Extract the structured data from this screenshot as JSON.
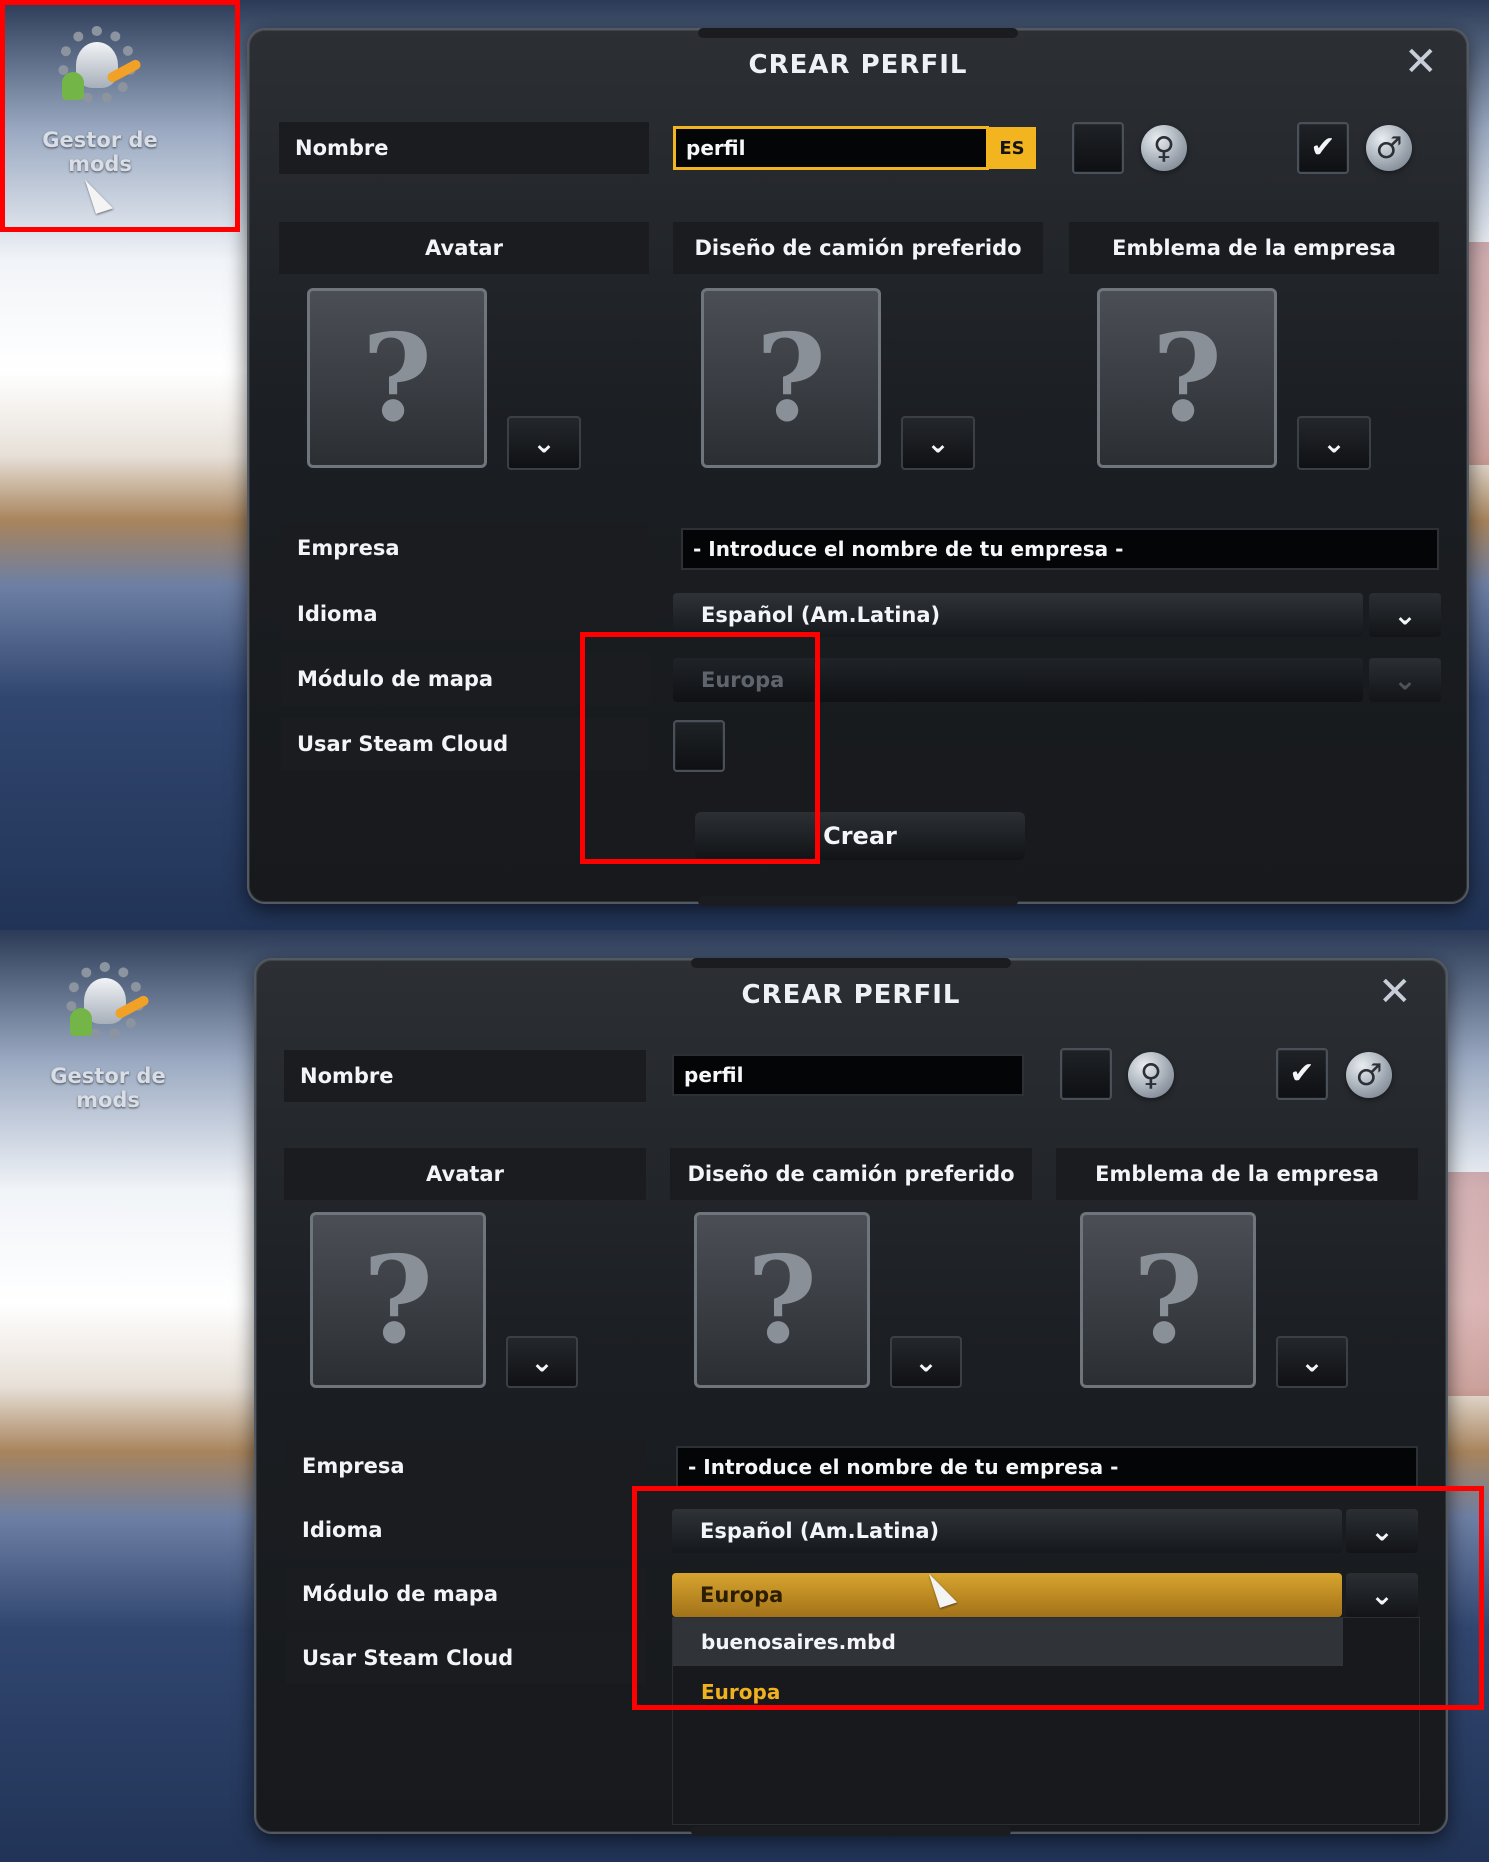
{
  "mod_manager": {
    "label": "Gestor de mods",
    "icon": "mod-manager-icon"
  },
  "dialog": {
    "title": "CREAR PERFIL",
    "close_icon": "close-icon"
  },
  "profile": {
    "name_label": "Nombre",
    "name_value": "perfil",
    "language_badge": "ES",
    "avatar_header": "Avatar",
    "truck_header": "Diseño de camión preferido",
    "emblem_header": "Emblema de la empresa",
    "company_label": "Empresa",
    "company_placeholder": "- Introduce el nombre de tu empresa -",
    "language_label": "Idioma",
    "language_value": "Español (Am.Latina)",
    "map_label": "Módulo de mapa",
    "map_value": "Europa",
    "steam_label": "Usar Steam Cloud",
    "create_button": "Crear"
  },
  "map_dropdown_options": [
    "buenosaires.mbd",
    "Europa"
  ],
  "placeholder_symbol": "?",
  "dropdown_icon": "chevron-down-icon",
  "gender_icons": {
    "female": "female-icon",
    "male": "male-icon"
  },
  "accent_color": "#f2b41f",
  "highlight_color": "#ff0000"
}
